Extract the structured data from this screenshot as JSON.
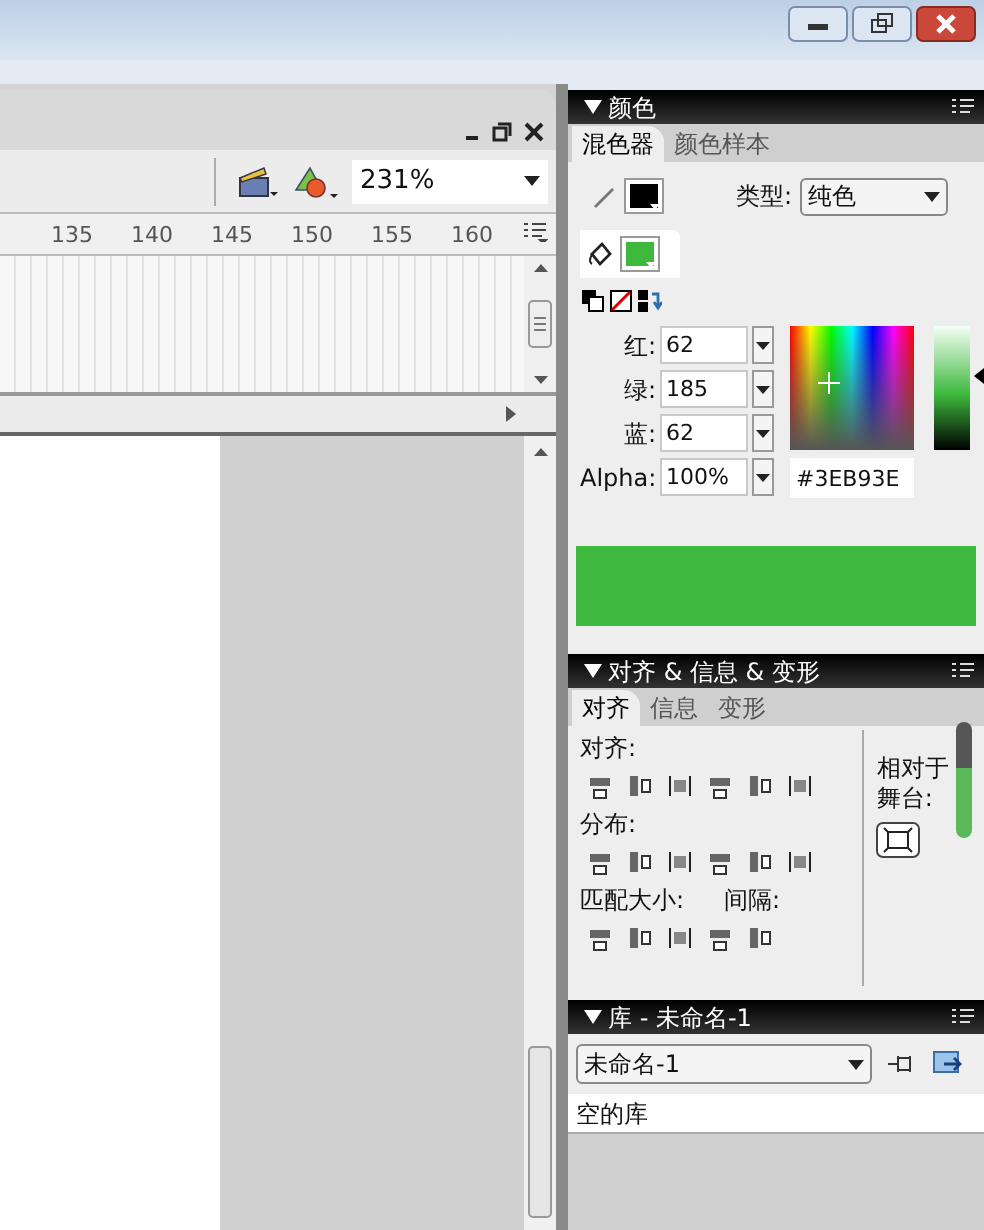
{
  "document": {
    "zoom": "231%",
    "ruler_ticks": [
      "135",
      "140",
      "145",
      "150",
      "155",
      "160"
    ]
  },
  "color_panel": {
    "title": "颜色",
    "tabs": [
      {
        "label": "混色器",
        "selected": true
      },
      {
        "label": "颜色样本",
        "selected": false
      }
    ],
    "type_label": "类型:",
    "type_value": "纯色",
    "channels": [
      {
        "label": "红:",
        "value": "62"
      },
      {
        "label": "绿:",
        "value": "185"
      },
      {
        "label": "蓝:",
        "value": "62"
      }
    ],
    "alpha_label": "Alpha:",
    "alpha_value": "100%",
    "hex": "#3EB93E",
    "brightness": {
      "level": 0.6
    }
  },
  "align_panel": {
    "title": "对齐 & 信息 & 变形",
    "tabs": [
      {
        "label": "对齐",
        "selected": true
      },
      {
        "label": "信息",
        "selected": false
      },
      {
        "label": "变形",
        "selected": false
      }
    ],
    "align_label": "对齐:",
    "distribute_label": "分布:",
    "match_label": "匹配大小:",
    "space_label": "间隔:",
    "stage_label": "相对于舞台:"
  },
  "library_panel": {
    "title": "库 - 未命名-1",
    "document_select": "未命名-1",
    "empty_text": "空的库"
  }
}
